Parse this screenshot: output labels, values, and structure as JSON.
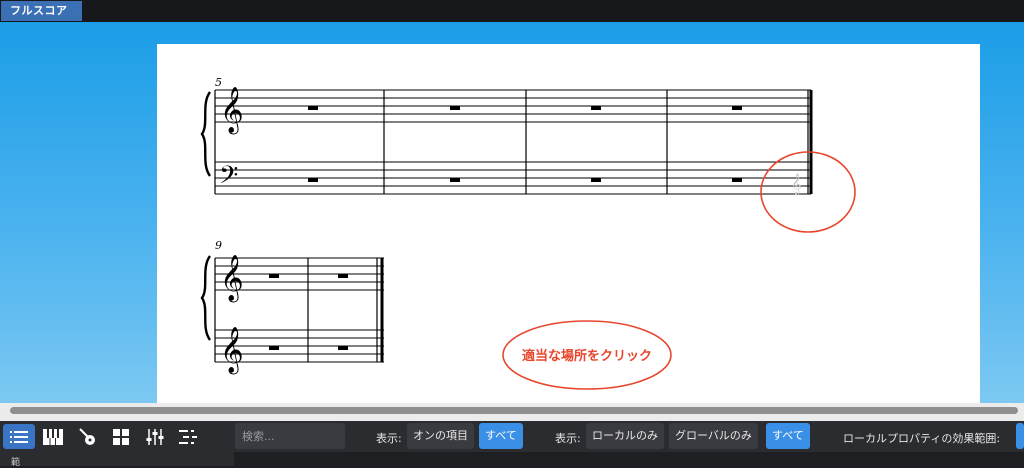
{
  "tab": {
    "label": "フルスコア"
  },
  "score": {
    "measure_numbers": [
      "5",
      "9"
    ],
    "annotation": "適当な場所をクリック"
  },
  "toolbar": {
    "icons": [
      "list-icon",
      "piano-icon",
      "guitar-icon",
      "grid-icon",
      "mixer-icon",
      "tracks-icon"
    ],
    "search_placeholder": "検索...",
    "show_label_1": "表示:",
    "on_items": "オンの項目",
    "all_1": "すべて",
    "show_label_2": "表示:",
    "local_only": "ローカルのみ",
    "global_only": "グローバルのみ",
    "all_2": "すべて",
    "local_property_range": "ローカルプロパティの効果範囲:"
  },
  "bottom": {
    "label": "範"
  },
  "colors": {
    "accent": "#3a8fe6",
    "annotation": "#e8462d"
  }
}
